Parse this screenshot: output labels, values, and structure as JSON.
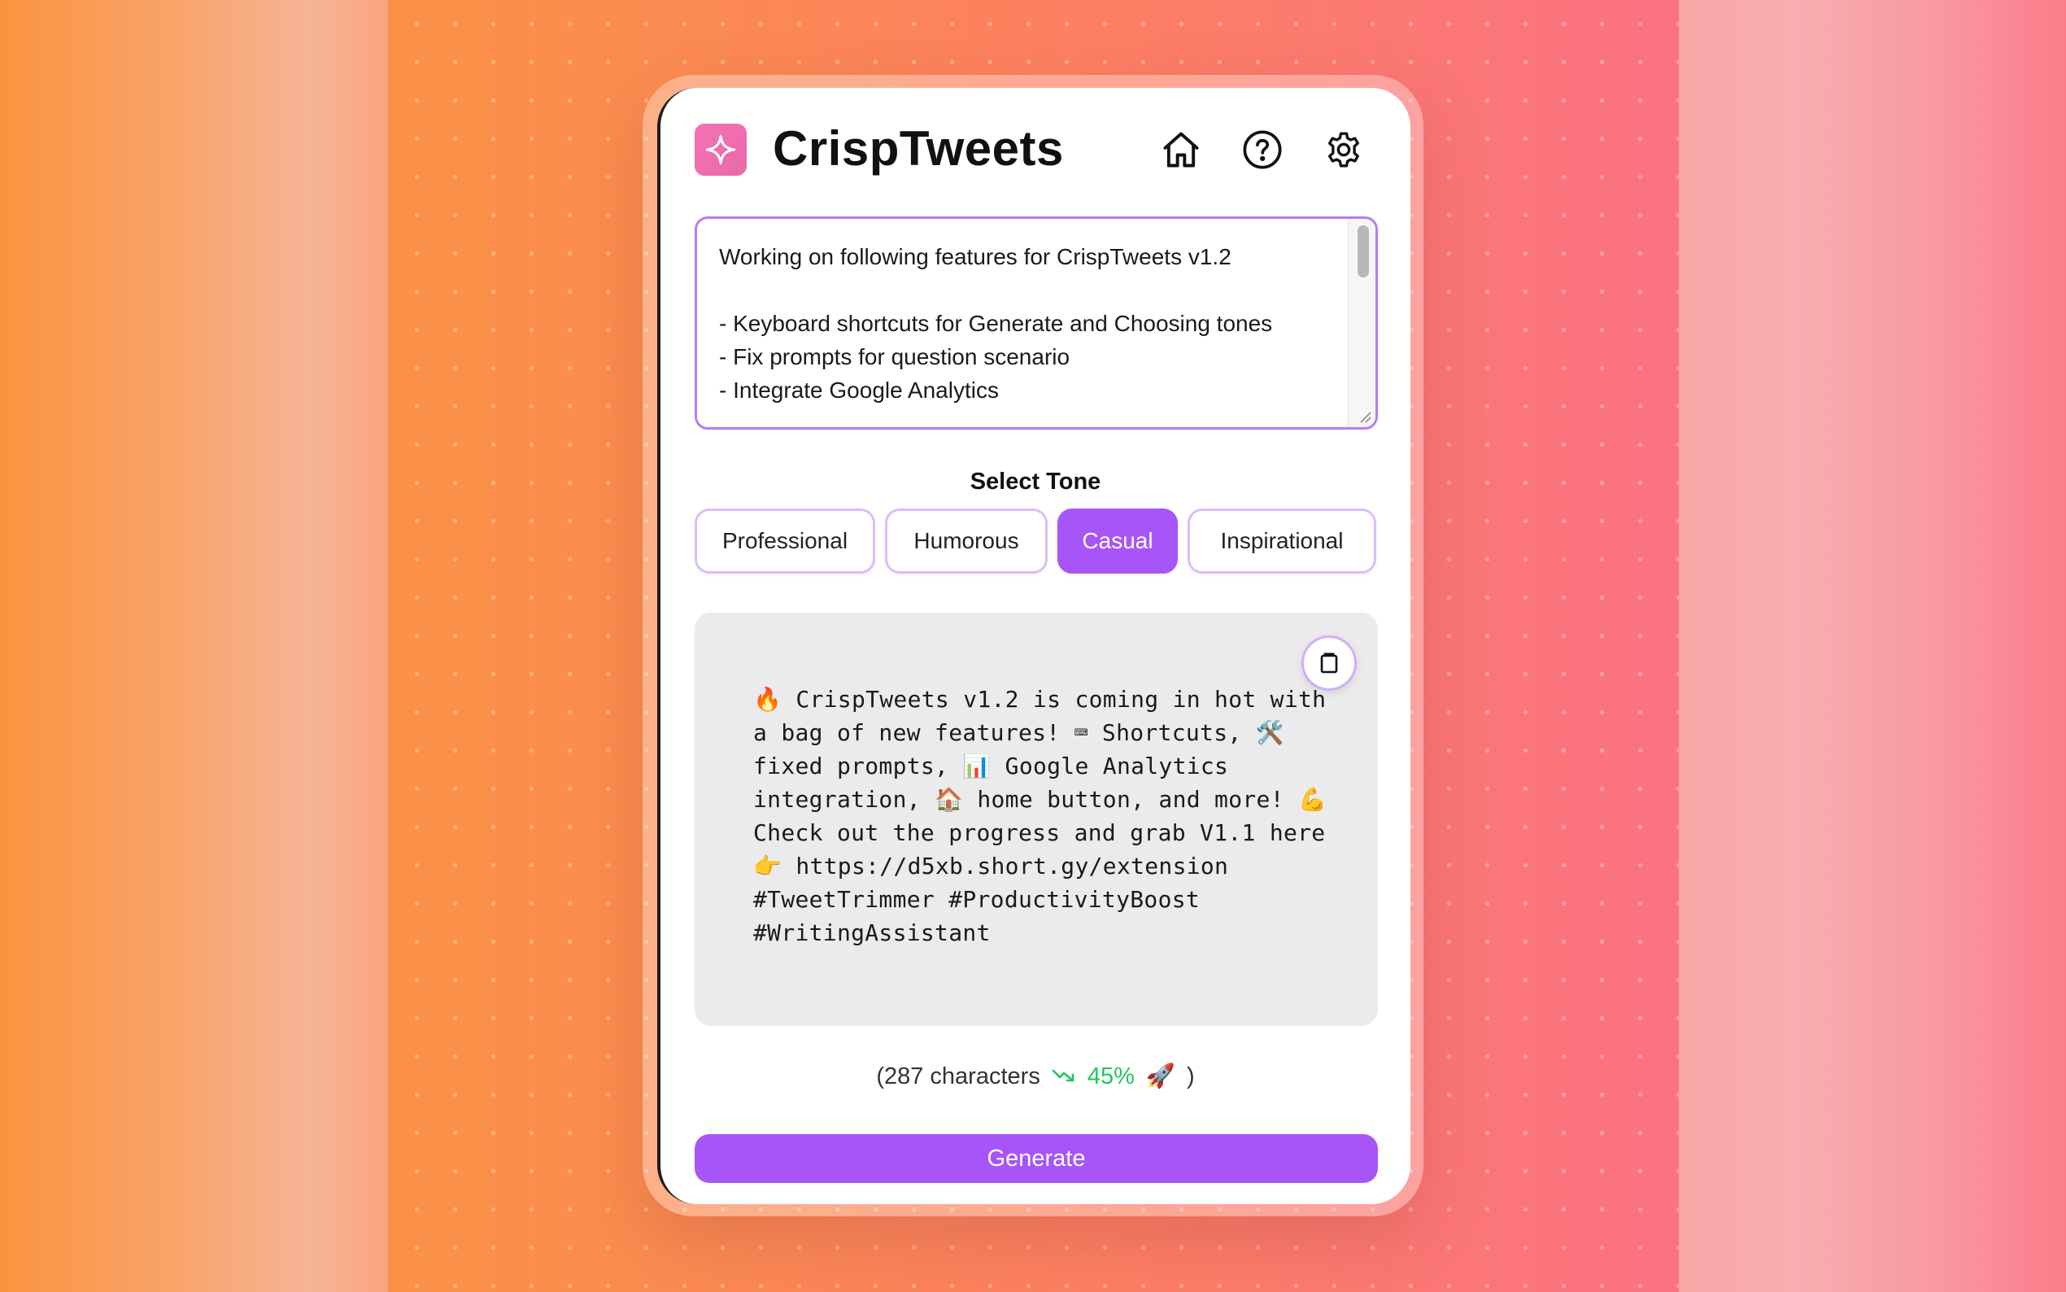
{
  "app": {
    "title": "CrispTweets"
  },
  "header_icons": [
    "home-icon",
    "help-icon",
    "settings-icon"
  ],
  "input": {
    "text": "Working on following features for CrispTweets v1.2\n\n- Keyboard shortcuts for Generate and Choosing tones\n- Fix prompts for question scenario\n- Integrate Google Analytics"
  },
  "tone": {
    "label": "Select Tone",
    "options": [
      "Professional",
      "Humorous",
      "Casual",
      "Inspirational"
    ],
    "selected": "Casual"
  },
  "output": {
    "text": "🔥 CrispTweets v1.2 is coming in hot with a bag of new features! ⌨ Shortcuts, 🛠️ fixed prompts, 📊 Google Analytics integration, 🏠 home button, and more! 💪 Check out the progress and grab V1.1 here 👉 https://d5xb.short.gy/extension #TweetTrimmer #ProductivityBoost #WritingAssistant"
  },
  "stats": {
    "open_paren": "(287 characters",
    "percent": "45%",
    "rocket": "🚀",
    "close_paren": ")"
  },
  "actions": {
    "generate_label": "Generate"
  },
  "colors": {
    "accent": "#a855f7",
    "logo": "#f472b6",
    "success": "#22c55e"
  }
}
